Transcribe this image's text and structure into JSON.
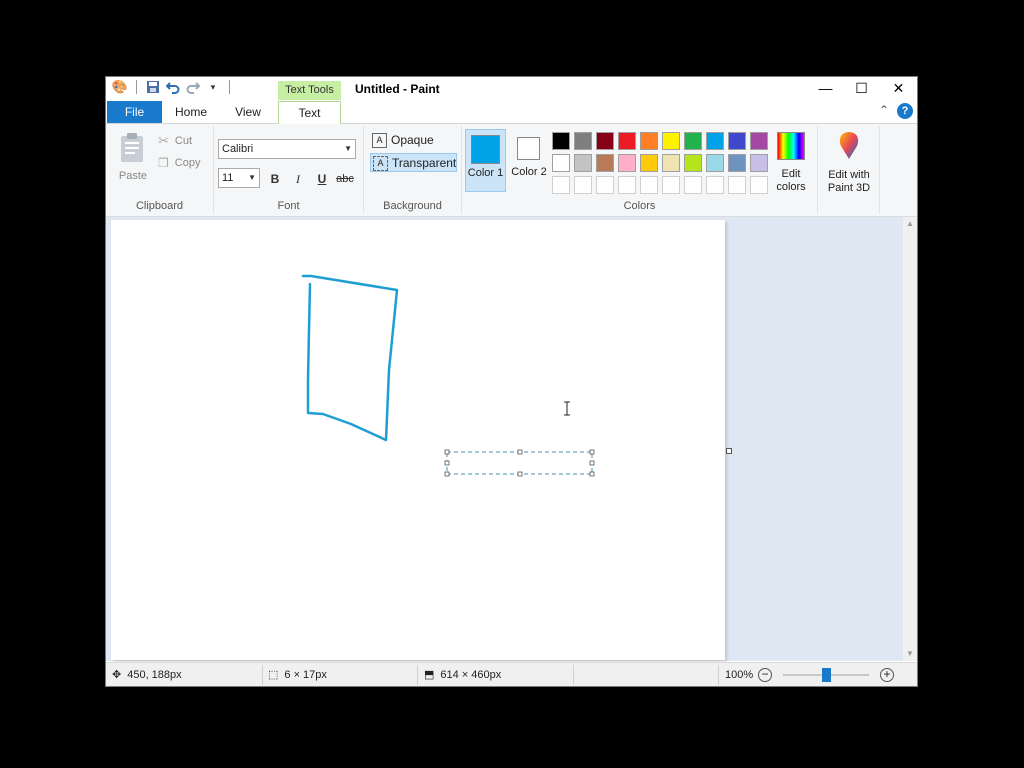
{
  "window": {
    "title": "Untitled - Paint",
    "context_tab_group": "Text Tools"
  },
  "caption_buttons": {
    "minimize": "—",
    "maximize": "☐",
    "close": "✕"
  },
  "tabs": {
    "file": "File",
    "home": "Home",
    "view": "View",
    "text": "Text"
  },
  "ribbon": {
    "clipboard": {
      "paste": "Paste",
      "cut": "Cut",
      "copy": "Copy",
      "label": "Clipboard"
    },
    "font": {
      "family": "Calibri",
      "size": "11",
      "bold": "B",
      "italic": "I",
      "underline": "U",
      "strike": "abc",
      "label": "Font"
    },
    "background": {
      "opaque": "Opaque",
      "transparent": "Transparent",
      "label": "Background"
    },
    "colors": {
      "color1": "Color 1",
      "color2": "Color 2",
      "color1_value": "#00a2e8",
      "color2_value": "#ffffff",
      "edit_colors": "Edit colors",
      "edit_3d": "Edit with Paint 3D",
      "label": "Colors",
      "palette_row1": [
        "#000000",
        "#7f7f7f",
        "#880015",
        "#ed1c24",
        "#ff7f27",
        "#fff200",
        "#22b14c",
        "#00a2e8",
        "#3f48cc",
        "#a349a4"
      ],
      "palette_row2": [
        "#ffffff",
        "#c3c3c3",
        "#b97a57",
        "#ffaec9",
        "#ffc90e",
        "#efe4b0",
        "#b5e61d",
        "#99d9ea",
        "#7092be",
        "#c8bfe7"
      ],
      "palette_row3": [
        "#ffffff",
        "#ffffff",
        "#ffffff",
        "#ffffff",
        "#ffffff",
        "#ffffff",
        "#ffffff",
        "#ffffff",
        "#ffffff",
        "#ffffff"
      ]
    }
  },
  "status": {
    "cursor_pos": "450, 188px",
    "selection_size": "6 × 17px",
    "canvas_size": "614 × 460px",
    "zoom": "100%",
    "zoom_level": 0.5
  }
}
